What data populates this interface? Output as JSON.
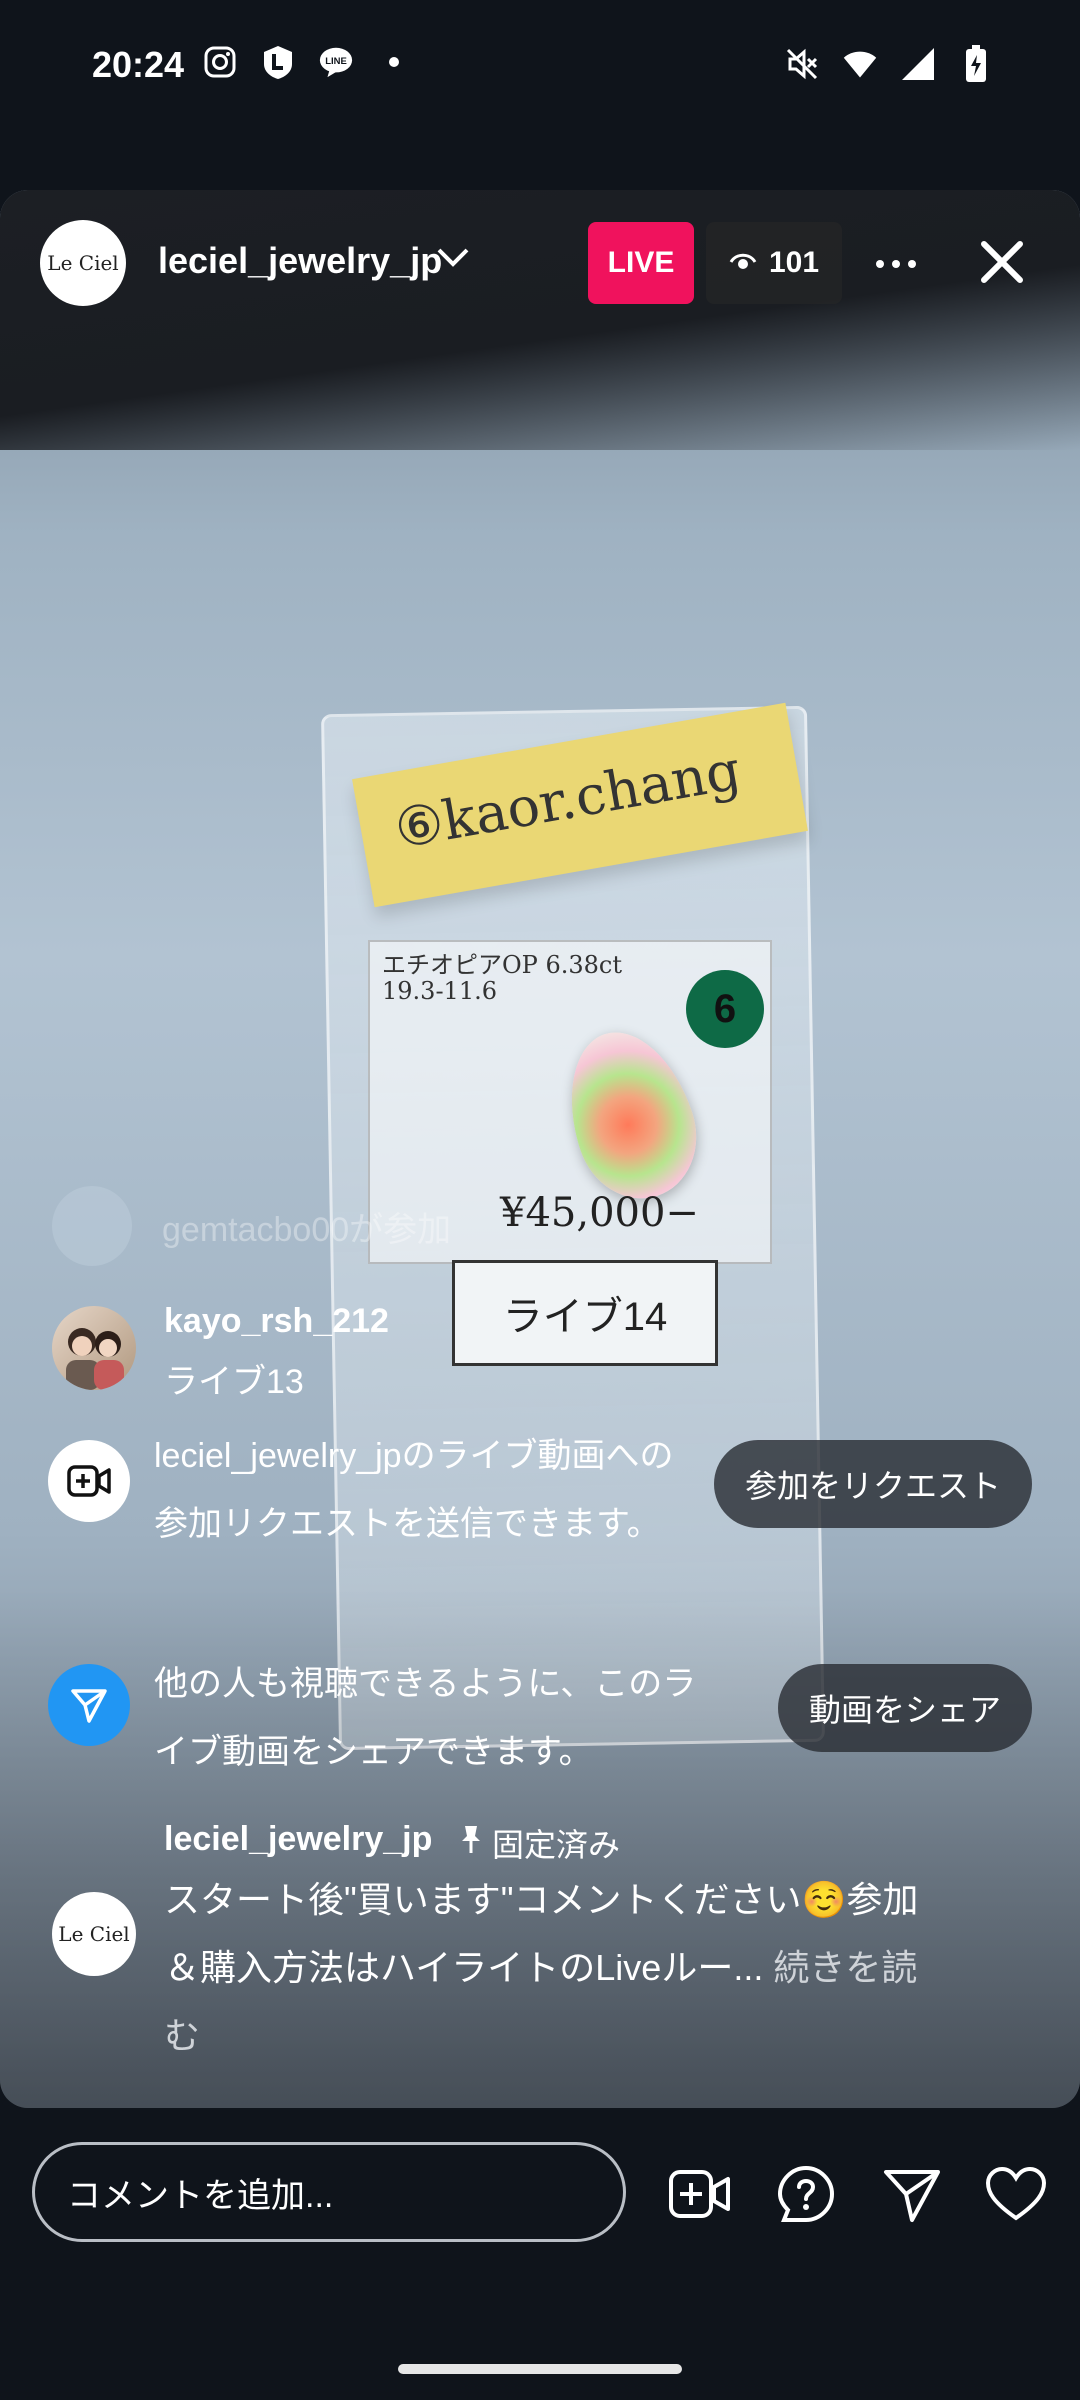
{
  "status_bar": {
    "time": "20:24",
    "left_icons": [
      "instagram-icon",
      "line-l-icon",
      "line-chat-icon",
      "dot-icon"
    ],
    "right_icons": [
      "mute-icon",
      "wifi-icon",
      "signal-icon",
      "battery-charging-icon"
    ]
  },
  "live_header": {
    "username": "leciel_jewelry_jp",
    "avatar_text": "Le Ciel",
    "live_label": "LIVE",
    "viewer_count": "101"
  },
  "video_content": {
    "sticky_note": "⑥kaor.chang",
    "card_label": "エチオピアOP 6.38ct\n19.3-11.6",
    "number_badge": "6",
    "price": "¥45,000−",
    "tag": "ライブ14"
  },
  "chat": {
    "faded_message": "gemtacbo00が参加",
    "comment": {
      "username": "kayo_rsh_212",
      "text": "ライブ13"
    },
    "system_request": {
      "text": "leciel_jewelry_jpのライブ動画への参加リクエストを送信できます。",
      "button": "参加をリクエスト"
    },
    "system_share": {
      "text": "他の人も視聴できるように、このライブ動画をシェアできます。",
      "button": "動画をシェア"
    },
    "pinned": {
      "username": "leciel_jewelry_jp",
      "pinned_label": "固定済み",
      "text": "スタート後\"買います\"コメントください☺️参加＆購入方法はハイライトのLiveルー...",
      "more": "続きを読む",
      "avatar_text": "Le Ciel"
    }
  },
  "bottom_bar": {
    "comment_placeholder": "コメントを追加...",
    "icons": [
      "add-video-icon",
      "question-icon",
      "send-icon",
      "heart-icon"
    ]
  }
}
